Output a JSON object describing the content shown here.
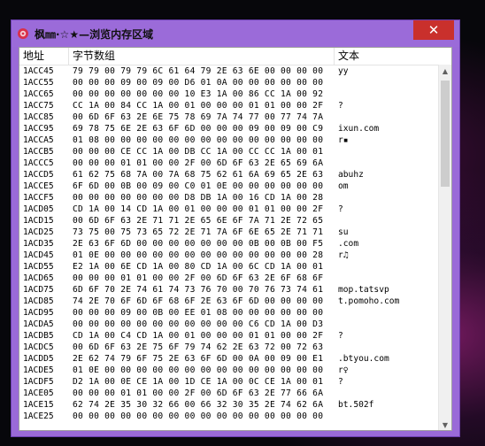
{
  "window": {
    "title": "枫㎜·☆★—浏览内存区域",
    "close_label": "✕"
  },
  "table": {
    "headers": [
      "地址",
      "字节数组",
      "文本"
    ],
    "rows": [
      {
        "addr": "1ACC45",
        "bytes": "79 79 00 79 79 6C 61 64 79 2E 63 6E 00 00 00 00",
        "text": "yy"
      },
      {
        "addr": "1ACC55",
        "bytes": "00 00 00 09 00 09 00 D6 01 0A 00 00 00 00 00 00",
        "text": ""
      },
      {
        "addr": "1ACC65",
        "bytes": "00 00 00 00 00 00 00 10 E3 1A 00 86 CC 1A 00 92",
        "text": ""
      },
      {
        "addr": "1ACC75",
        "bytes": "CC 1A 00 84 CC 1A 00 01 00 00 00 01 01 00 00 2F",
        "text": "?"
      },
      {
        "addr": "1ACC85",
        "bytes": "00 6D 6F 63 2E 6E 75 78 69 7A 74 77 00 77 74 7A",
        "text": ""
      },
      {
        "addr": "1ACC95",
        "bytes": "69 78 75 6E 2E 63 6F 6D 00 00 00 09 00 09 00 C9",
        "text": "ixun.com"
      },
      {
        "addr": "1ACCA5",
        "bytes": "01 08 00 00 00 00 00 00 00 00 00 00 00 00 00 00",
        "text": "r▪"
      },
      {
        "addr": "1ACCB5",
        "bytes": "00 00 00 CE CC 1A 00 DB CC 1A 00 CC CC 1A 00 01",
        "text": ""
      },
      {
        "addr": "1ACCC5",
        "bytes": "00 00 00 01 01 00 00 2F 00 6D 6F 63 2E 65 69 6A",
        "text": ""
      },
      {
        "addr": "1ACCD5",
        "bytes": "61 62 75 68 7A 00 7A 68 75 62 61 6A 69 65 2E 63",
        "text": "abuhz"
      },
      {
        "addr": "1ACCE5",
        "bytes": "6F 6D 00 0B 00 09 00 C0 01 0E 00 00 00 00 00 00",
        "text": "om"
      },
      {
        "addr": "1ACCF5",
        "bytes": "00 00 00 00 00 00 00 D8 DB 1A 00 16 CD 1A 00 28",
        "text": ""
      },
      {
        "addr": "1ACD05",
        "bytes": "CD 1A 00 14 CD 1A 00 01 00 00 00 01 01 00 00 2F",
        "text": "?"
      },
      {
        "addr": "1ACD15",
        "bytes": "00 6D 6F 63 2E 71 71 2E 65 6E 6F 7A 71 2E 72 65",
        "text": ""
      },
      {
        "addr": "1ACD25",
        "bytes": "73 75 00 75 73 65 72 2E 71 7A 6F 6E 65 2E 71 71",
        "text": "su"
      },
      {
        "addr": "1ACD35",
        "bytes": "2E 63 6F 6D 00 00 00 00 00 00 00 0B 00 0B 00 F5",
        "text": ".com"
      },
      {
        "addr": "1ACD45",
        "bytes": "01 0E 00 00 00 00 00 00 00 00 00 00 00 00 00 28",
        "text": "r♫"
      },
      {
        "addr": "1ACD55",
        "bytes": "E2 1A 00 6E CD 1A 00 80 CD 1A 00 6C CD 1A 00 01",
        "text": ""
      },
      {
        "addr": "1ACD65",
        "bytes": "00 00 00 01 01 00 00 2F 00 6D 6F 63 2E 6F 68 6F",
        "text": ""
      },
      {
        "addr": "1ACD75",
        "bytes": "6D 6F 70 2E 74 61 74 73 76 70 00 70 76 73 74 61",
        "text": "mop.tatsvp"
      },
      {
        "addr": "1ACD85",
        "bytes": "74 2E 70 6F 6D 6F 68 6F 2E 63 6F 6D 00 00 00 00",
        "text": "t.pomoho.com"
      },
      {
        "addr": "1ACD95",
        "bytes": "00 00 00 09 00 0B 00 EE 01 08 00 00 00 00 00 00",
        "text": ""
      },
      {
        "addr": "1ACDA5",
        "bytes": "00 00 00 00 00 00 00 00 00 00 00 C6 CD 1A 00 D3",
        "text": ""
      },
      {
        "addr": "1ACDB5",
        "bytes": "CD 1A 00 C4 CD 1A 00 01 00 00 00 01 01 00 00 2F",
        "text": "?"
      },
      {
        "addr": "1ACDC5",
        "bytes": "00 6D 6F 63 2E 75 6F 79 74 62 2E 63 72 00 72 63",
        "text": ""
      },
      {
        "addr": "1ACDD5",
        "bytes": "2E 62 74 79 6F 75 2E 63 6F 6D 00 0A 00 09 00 E1",
        "text": ".btyou.com"
      },
      {
        "addr": "1ACDE5",
        "bytes": "01 0E 00 00 00 00 00 00 00 00 00 00 00 00 00 00",
        "text": "r♀"
      },
      {
        "addr": "1ACDF5",
        "bytes": "D2 1A 00 0E CE 1A 00 1D CE 1A 00 0C CE 1A 00 01",
        "text": "?"
      },
      {
        "addr": "1ACE05",
        "bytes": "00 00 00 01 01 00 00 2F 00 6D 6F 63 2E 77 66 6A",
        "text": ""
      },
      {
        "addr": "1ACE15",
        "bytes": "62 74 2E 35 30 32 66 00 66 32 30 35 2E 74 62 6A",
        "text": "bt.502f"
      },
      {
        "addr": "1ACE25",
        "bytes": "00 00 00 00 00 00 00 00 00 00 00 00 00 00 00 00",
        "text": ""
      }
    ]
  },
  "colors": {
    "titlebar": "#9b6bd9",
    "close_button": "#c9302c"
  }
}
